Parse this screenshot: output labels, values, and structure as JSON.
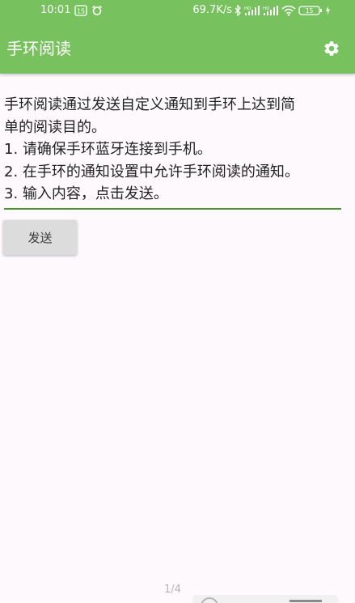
{
  "status_bar": {
    "time": "10:01",
    "notification_badge": "15",
    "network_speed": "69.7K/s",
    "battery_level": "15",
    "icons": [
      "notification-badge-icon",
      "alarm-icon",
      "bluetooth-icon",
      "signal-hd-icon",
      "signal-hd-icon",
      "wifi-icon",
      "battery-icon",
      "charging-icon"
    ]
  },
  "app_bar": {
    "title": "手环阅读",
    "settings_icon": "gear-icon",
    "background_color": "#78c15f"
  },
  "content": {
    "lines": [
      "手环阅读通过发送自定义通知到手环上达到简",
      "单的阅读目的。",
      "1. 请确保手环蓝牙连接到手机。",
      "2. 在手环的通知设置中允许手环阅读的通知。",
      "3. 输入内容，点击发送。"
    ],
    "underline_color": "#47912f"
  },
  "send_button": {
    "label": "发送"
  },
  "footer": {
    "page_indicator": "1/4"
  }
}
